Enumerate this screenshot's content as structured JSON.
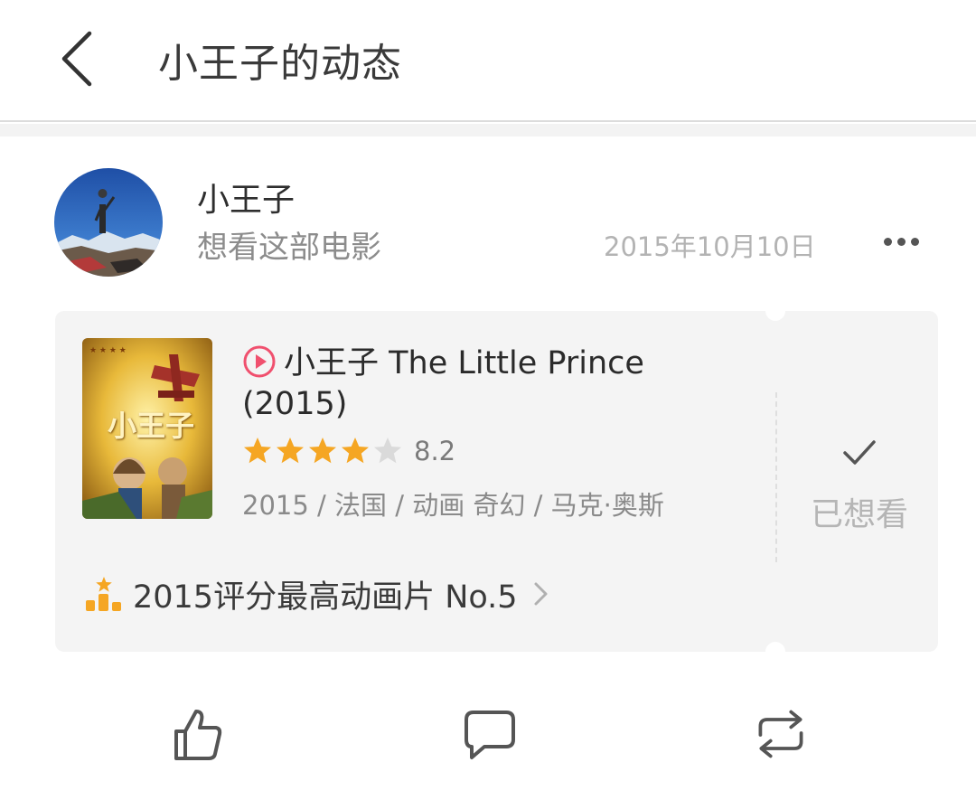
{
  "header": {
    "title": "小王子的动态",
    "back_icon": "chevron-left-icon"
  },
  "post": {
    "user_name": "小王子",
    "action": "想看这部电影",
    "date": "2015年10月10日",
    "more_icon": "more-dots-icon"
  },
  "movie": {
    "play_icon": "play-circle-icon",
    "title_line1": "小王子 The Little Prince",
    "title_line2": "(2015)",
    "poster_text": "小王子",
    "rating": 8.2,
    "rating_display": "8.2",
    "stars_filled": 4,
    "stars_total": 5,
    "meta": "2015 / 法国 / 动画 奇幻 / 马克·奥斯",
    "wish_label": "已想看",
    "wish_icon": "checkmark-icon"
  },
  "ranking": {
    "text": "2015评分最高动画片 No.5",
    "icon": "ranking-podium-icon"
  },
  "footer": {
    "like_icon": "thumbs-up-icon",
    "comment_icon": "comment-icon",
    "repost_icon": "repost-icon"
  },
  "colors": {
    "star_active": "#f5a623",
    "star_inactive": "#dadada",
    "play_icon": "#f0506e",
    "ranking_icon": "#f5a623",
    "card_background": "#f4f4f4"
  }
}
